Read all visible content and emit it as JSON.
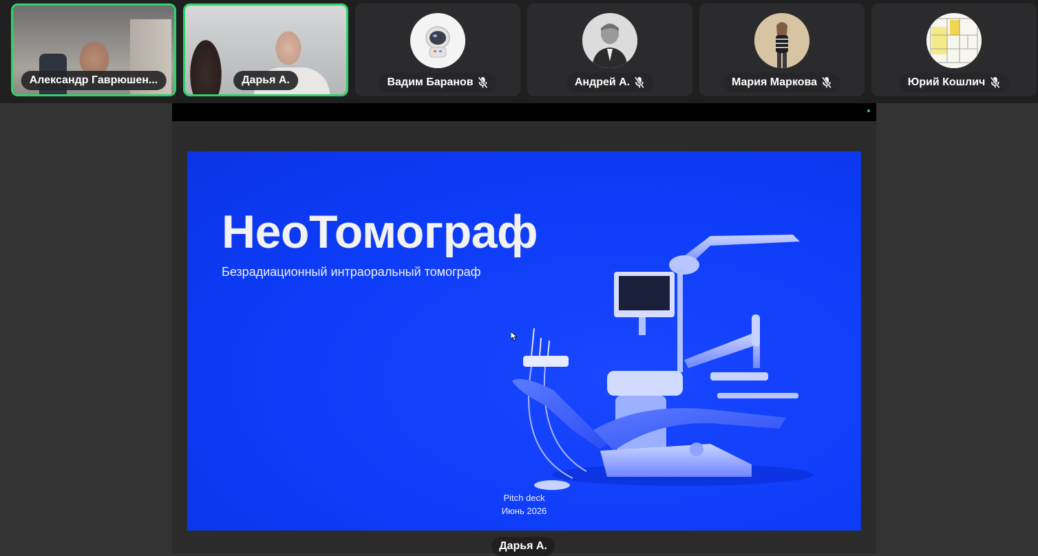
{
  "participants": [
    {
      "name": "Александр Гаврюшен...",
      "speaking": true,
      "muted": false,
      "type": "video"
    },
    {
      "name": "Дарья А.",
      "speaking": true,
      "muted": false,
      "type": "video"
    },
    {
      "name": "Вадим Баранов",
      "speaking": false,
      "muted": true,
      "type": "avatar",
      "avatar_icon": "astronaut-avatar"
    },
    {
      "name": "Андрей А.",
      "speaking": false,
      "muted": true,
      "type": "avatar",
      "avatar_icon": "man-photo-avatar"
    },
    {
      "name": "Мария Маркова",
      "speaking": false,
      "muted": true,
      "type": "avatar",
      "avatar_icon": "woman-photo-avatar"
    },
    {
      "name": "Юрий Кошлич",
      "speaking": false,
      "muted": true,
      "type": "avatar",
      "avatar_icon": "floorplan-avatar"
    }
  ],
  "slide": {
    "title": "НеоТомограф",
    "subtitle": "Безрадиационный интраоральный томограф",
    "footer_line1": "Pitch deck",
    "footer_line2": "Июнь 2026",
    "image_icon": "dental-chair-illustration"
  },
  "presenter": {
    "name": "Дарья А."
  },
  "colors": {
    "speaking_border": "#2bd46a",
    "slide_background": "#0d3cf8",
    "strip_background": "#1f1f1f",
    "tile_background": "#2b2b2d"
  },
  "icons": {
    "mic_off": "mic-off-icon",
    "status": "status-dot"
  }
}
